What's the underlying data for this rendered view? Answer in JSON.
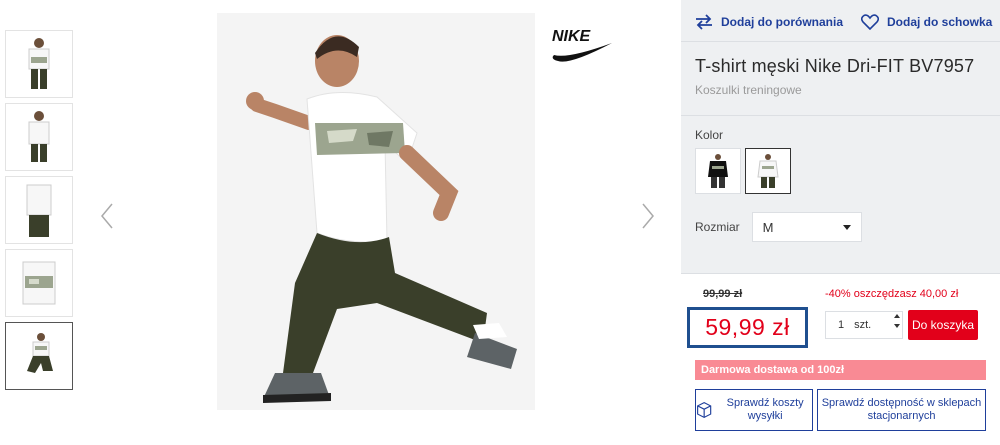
{
  "gallery": {
    "thumbnails": [
      "thumb-1",
      "thumb-2",
      "thumb-3",
      "thumb-4",
      "thumb-5"
    ],
    "active_index": 4
  },
  "brand": {
    "logo": "NIKE"
  },
  "actions": {
    "compare_label": "Dodaj do porównania",
    "wishlist_label": "Dodaj do schowka"
  },
  "product": {
    "title": "T-shirt męski Nike Dri-FIT BV7957",
    "category": "Koszulki treningowe"
  },
  "color": {
    "label": "Kolor",
    "options": [
      "black-shirt",
      "white-camo-shirt"
    ],
    "selected_index": 1
  },
  "size": {
    "label": "Rozmiar",
    "selected": "M"
  },
  "pricing": {
    "old_price": "99,99 zł",
    "discount_text": "-40% oszczędzasz 40,00 zł",
    "price": "59,99 zł",
    "quantity": "1",
    "unit": "szt.",
    "add_to_cart": "Do koszyka"
  },
  "shipping_banner": "Darmowa dostawa od 100zł",
  "buttons": {
    "shipping_cost": "Sprawdź koszty wysyłki",
    "store_availability": "Sprawdź dostępność w sklepach stacjonarnych"
  },
  "colors": {
    "accent_blue": "#1f3f9b",
    "price_red": "#e2001a",
    "banner_pink": "#f98a94",
    "panel_bg": "#eef0f2"
  }
}
